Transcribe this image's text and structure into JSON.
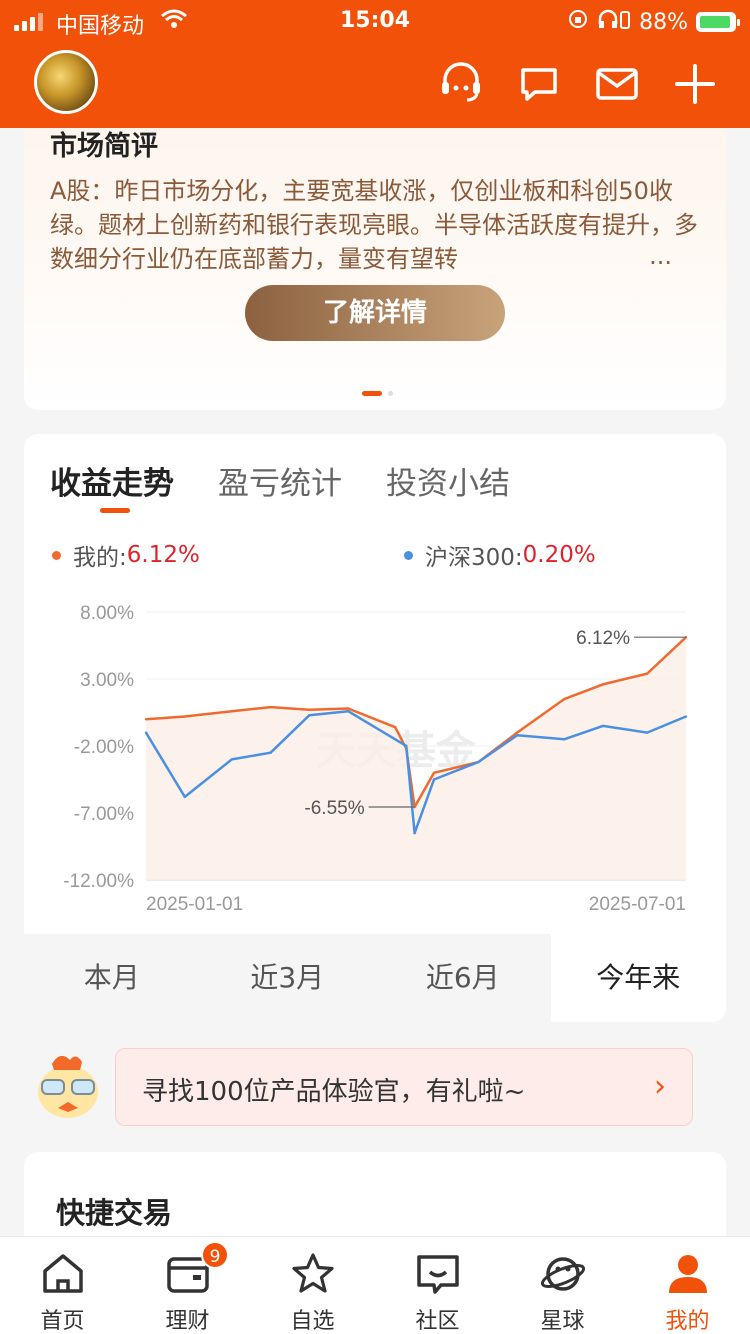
{
  "status_bar": {
    "carrier": "中国移动",
    "time": "15:04",
    "battery": "88%"
  },
  "colors": {
    "brand": "#f2510a",
    "mine": "#ee6a2f",
    "index": "#4a90e2",
    "up": "#e0222a"
  },
  "header": {
    "icons": [
      "avatar",
      "customer-service-icon",
      "chat-icon",
      "mail-icon",
      "plus-icon"
    ]
  },
  "market": {
    "title": "市场简评",
    "text": "A股：昨日市场分化，主要宽基收涨，仅创业板和科创50收绿。题材上创新药和银行表现亮眼。半导体活跃度有提升，多数细分行业仍在底部蓄力，量变有望转",
    "more": "...",
    "button": "了解详情"
  },
  "tabs": [
    "收益走势",
    "盈亏统计",
    "投资小结"
  ],
  "legend": {
    "mine_label": "我的:",
    "mine_value": "6.12%",
    "index_label": "沪深300:",
    "index_value": "0.20%"
  },
  "chart_data": {
    "type": "line",
    "title": "",
    "xlabel": "",
    "ylabel": "",
    "x_ticks": [
      "2025-01-01",
      "2025-07-01"
    ],
    "y_ticks": [
      "8.00%",
      "3.00%",
      "-2.00%",
      "-7.00%",
      "-12.00%"
    ],
    "ylim": [
      -12,
      8
    ],
    "x": [
      "2025-01-01",
      "2025-01-15",
      "2025-02-01",
      "2025-02-15",
      "2025-03-01",
      "2025-03-15",
      "2025-04-01",
      "2025-04-05",
      "2025-04-08",
      "2025-04-15",
      "2025-05-01",
      "2025-05-15",
      "2025-06-01",
      "2025-06-15",
      "2025-07-01",
      "2025-07-15"
    ],
    "series": [
      {
        "name": "我的",
        "values": [
          0.0,
          0.2,
          0.6,
          0.9,
          0.7,
          0.8,
          -0.6,
          -2.2,
          -6.55,
          -4.0,
          -3.2,
          -1.0,
          1.5,
          2.6,
          3.4,
          6.12
        ]
      },
      {
        "name": "沪深300",
        "values": [
          -1.0,
          -5.8,
          -3.0,
          -2.5,
          0.3,
          0.6,
          -1.5,
          -2.0,
          -8.5,
          -4.5,
          -3.2,
          -1.2,
          -1.5,
          -0.5,
          -1.0,
          0.2
        ]
      }
    ],
    "annotations": [
      {
        "label": "6.12%",
        "x": "2025-07-15",
        "y": 6.12
      },
      {
        "label": "-6.55%",
        "x": "2025-04-08",
        "y": -6.55
      }
    ],
    "watermark": "天天基金",
    "grid": true
  },
  "ranges": [
    "本月",
    "近3月",
    "近6月",
    "今年来"
  ],
  "active_range": 3,
  "promo": {
    "text": "寻找100位产品体验官，有礼啦~",
    "arrow": "›"
  },
  "quick": {
    "title": "快捷交易"
  },
  "nav": [
    {
      "label": "首页",
      "icon": "home-icon"
    },
    {
      "label": "理财",
      "icon": "wallet-icon",
      "badge": "9"
    },
    {
      "label": "自选",
      "icon": "star-icon"
    },
    {
      "label": "社区",
      "icon": "community-icon"
    },
    {
      "label": "星球",
      "icon": "planet-icon"
    },
    {
      "label": "我的",
      "icon": "profile-icon"
    }
  ]
}
